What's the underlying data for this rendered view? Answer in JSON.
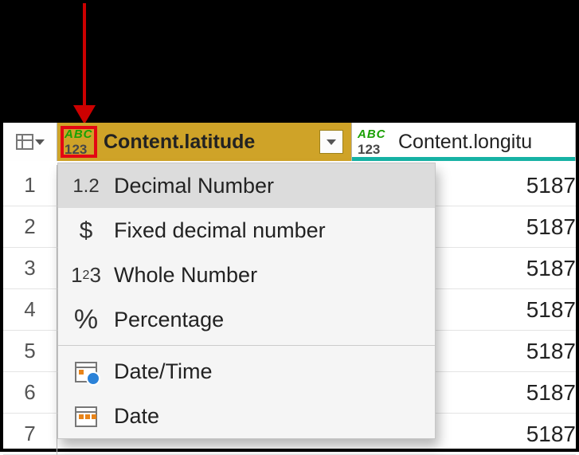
{
  "columns": {
    "col1": {
      "name": "Content.latitude"
    },
    "col2": {
      "name": "Content.longitu"
    }
  },
  "rows": {
    "r1": {
      "num": "1",
      "c2": "5187"
    },
    "r2": {
      "num": "2",
      "c2": "5187"
    },
    "r3": {
      "num": "3",
      "c2": "5187"
    },
    "r4": {
      "num": "4",
      "c2": "5187"
    },
    "r5": {
      "num": "5",
      "c2": "5187"
    },
    "r6": {
      "num": "6",
      "c2": "5187"
    },
    "r7": {
      "num": "7",
      "c2": "5187"
    }
  },
  "menu": {
    "decimal": "Decimal Number",
    "fixedDecimal": "Fixed decimal number",
    "whole": "Whole Number",
    "percentage": "Percentage",
    "dateTime": "Date/Time",
    "date": "Date"
  }
}
